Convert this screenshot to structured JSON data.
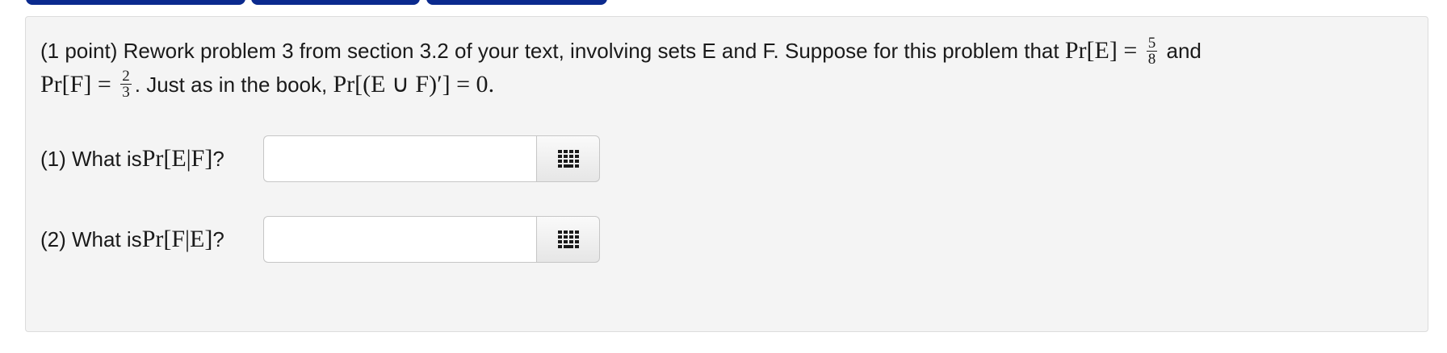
{
  "problem": {
    "intro": "(1 point) Rework problem 3 from section 3.2 of your text, involving sets E and F. Suppose for this problem that ",
    "pr_e": "Pr[E]",
    "equals": " = ",
    "pr_e_num": "5",
    "pr_e_den": "8",
    "and": "and",
    "pr_f": "Pr[F]",
    "pr_f_num": "2",
    "pr_f_den": "3",
    "mid": ". Just as in the book, ",
    "complement_expr": "Pr[(E ∪ F)′] = 0",
    "end": "."
  },
  "questions": [
    {
      "prefix": "(1) What is ",
      "expr": "Pr[E|F]",
      "suffix": "?",
      "value": "",
      "placeholder": ""
    },
    {
      "prefix": "(2) What is ",
      "expr": "Pr[F|E]",
      "suffix": "?",
      "value": "",
      "placeholder": ""
    }
  ],
  "colors": {
    "tab": "#0b2a8e",
    "panel_bg": "#f4f4f4"
  },
  "icons": {
    "keypad": "keypad-icon"
  }
}
